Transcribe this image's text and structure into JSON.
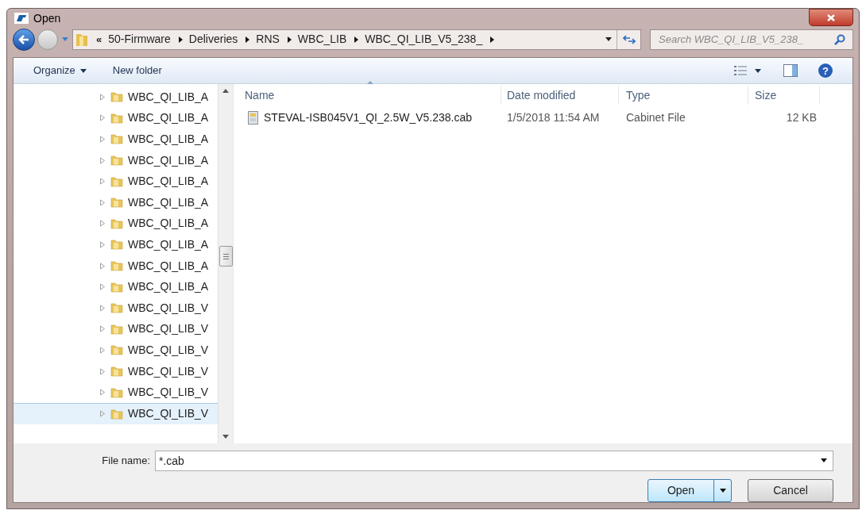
{
  "window": {
    "title": "Open"
  },
  "breadcrumb": {
    "overflow": "«",
    "segments": [
      "50-Firmware",
      "Deliveries",
      "RNS",
      "WBC_LIB",
      "WBC_QI_LIB_V5_238_"
    ]
  },
  "search": {
    "placeholder": "Search WBC_QI_LIB_V5_238_"
  },
  "toolbar": {
    "organize": "Organize",
    "new_folder": "New folder",
    "help": "?"
  },
  "tree": {
    "items": [
      {
        "label": "WBC_QI_LIB_A",
        "selected": false
      },
      {
        "label": "WBC_QI_LIB_A",
        "selected": false
      },
      {
        "label": "WBC_QI_LIB_A",
        "selected": false
      },
      {
        "label": "WBC_QI_LIB_A",
        "selected": false
      },
      {
        "label": "WBC_QI_LIB_A",
        "selected": false
      },
      {
        "label": "WBC_QI_LIB_A",
        "selected": false
      },
      {
        "label": "WBC_QI_LIB_A",
        "selected": false
      },
      {
        "label": "WBC_QI_LIB_A",
        "selected": false
      },
      {
        "label": "WBC_QI_LIB_A",
        "selected": false
      },
      {
        "label": "WBC_QI_LIB_A",
        "selected": false
      },
      {
        "label": "WBC_QI_LIB_V",
        "selected": false
      },
      {
        "label": "WBC_QI_LIB_V",
        "selected": false
      },
      {
        "label": "WBC_QI_LIB_V",
        "selected": false
      },
      {
        "label": "WBC_QI_LIB_V",
        "selected": false
      },
      {
        "label": "WBC_QI_LIB_V",
        "selected": false
      },
      {
        "label": "WBC_QI_LIB_V",
        "selected": true
      }
    ]
  },
  "table": {
    "columns": [
      {
        "label": "Name",
        "sorted": true
      },
      {
        "label": "Date modified",
        "sorted": false
      },
      {
        "label": "Type",
        "sorted": false
      },
      {
        "label": "Size",
        "sorted": false
      }
    ],
    "rows": [
      {
        "name": "STEVAL-ISB045V1_QI_2.5W_V5.238.cab",
        "date": "1/5/2018 11:54 AM",
        "type": "Cabinet File",
        "size": "12 KB"
      }
    ]
  },
  "file_name": {
    "label": "File name:",
    "value": "*.cab"
  },
  "buttons": {
    "open": "Open",
    "cancel": "Cancel"
  }
}
